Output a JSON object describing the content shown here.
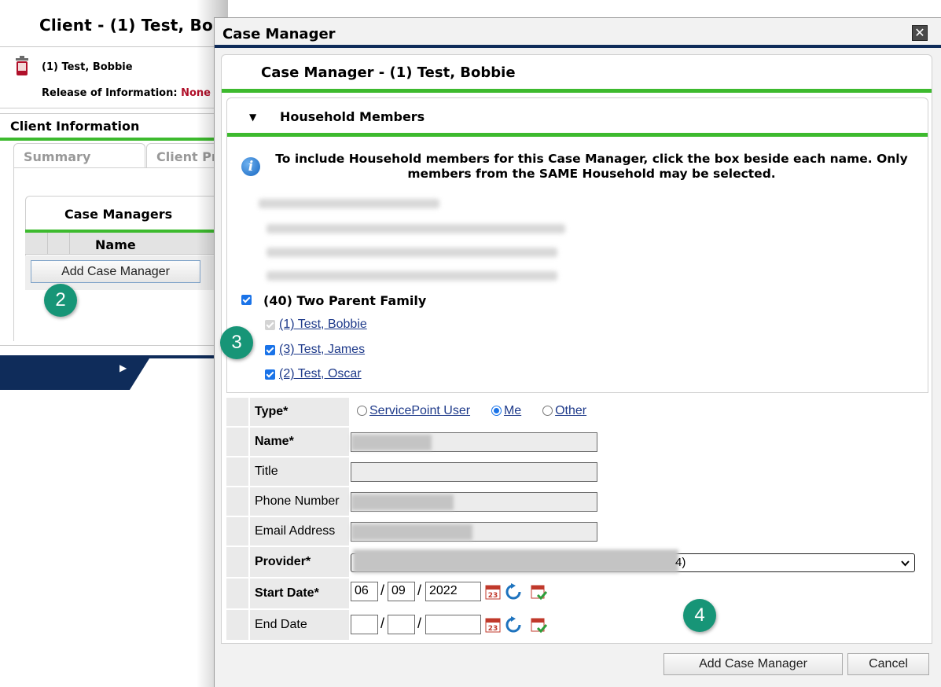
{
  "background": {
    "client_header": "Client - (1) Test, Bob",
    "client_name": "(1) Test, Bobbie",
    "roi_label": "Release of Information:",
    "roi_value": "None",
    "client_info_title": "Client Information",
    "tabs": [
      "Summary",
      "Client Pr"
    ],
    "case_managers_title": "Case Managers",
    "table_header_name": "Name",
    "add_button": "Add Case Manager"
  },
  "badges": {
    "step2": "2",
    "step3": "3",
    "step4": "4"
  },
  "modal": {
    "title": "Case Manager",
    "close_symbol": "✕",
    "subtitle": "Case Manager - (1) Test, Bobbie",
    "household": {
      "section_title": "Household Members",
      "info_text": "To include Household members for this Case Manager, click the box beside each name. Only members from the SAME Household may be selected.",
      "group": "(40) Two Parent Family",
      "members": [
        {
          "name": "(1) Test, Bobbie",
          "checked": true,
          "disabled": true
        },
        {
          "name": "(3) Test, James",
          "checked": true,
          "disabled": false
        },
        {
          "name": "(2) Test, Oscar",
          "checked": true,
          "disabled": false
        }
      ]
    },
    "form": {
      "type_label": "Type",
      "type_options": [
        "ServicePoint User",
        "Me",
        "Other"
      ],
      "type_selected": "Me",
      "name_label": "Name",
      "title_label": "Title",
      "phone_label": "Phone Number",
      "email_label": "Email Address",
      "provider_label": "Provider",
      "provider_suffix": "4)",
      "start_date_label": "Start Date",
      "start_date": {
        "month": "06",
        "day": "09",
        "year": "2022"
      },
      "end_date_label": "End Date",
      "required_mark": "*",
      "date_separator": "/"
    },
    "buttons": {
      "add": "Add Case Manager",
      "cancel": "Cancel"
    }
  },
  "colors": {
    "accent_green": "#3dba2e",
    "navy": "#0f2c5a",
    "badge": "#179577",
    "link": "#1e3a8a"
  }
}
